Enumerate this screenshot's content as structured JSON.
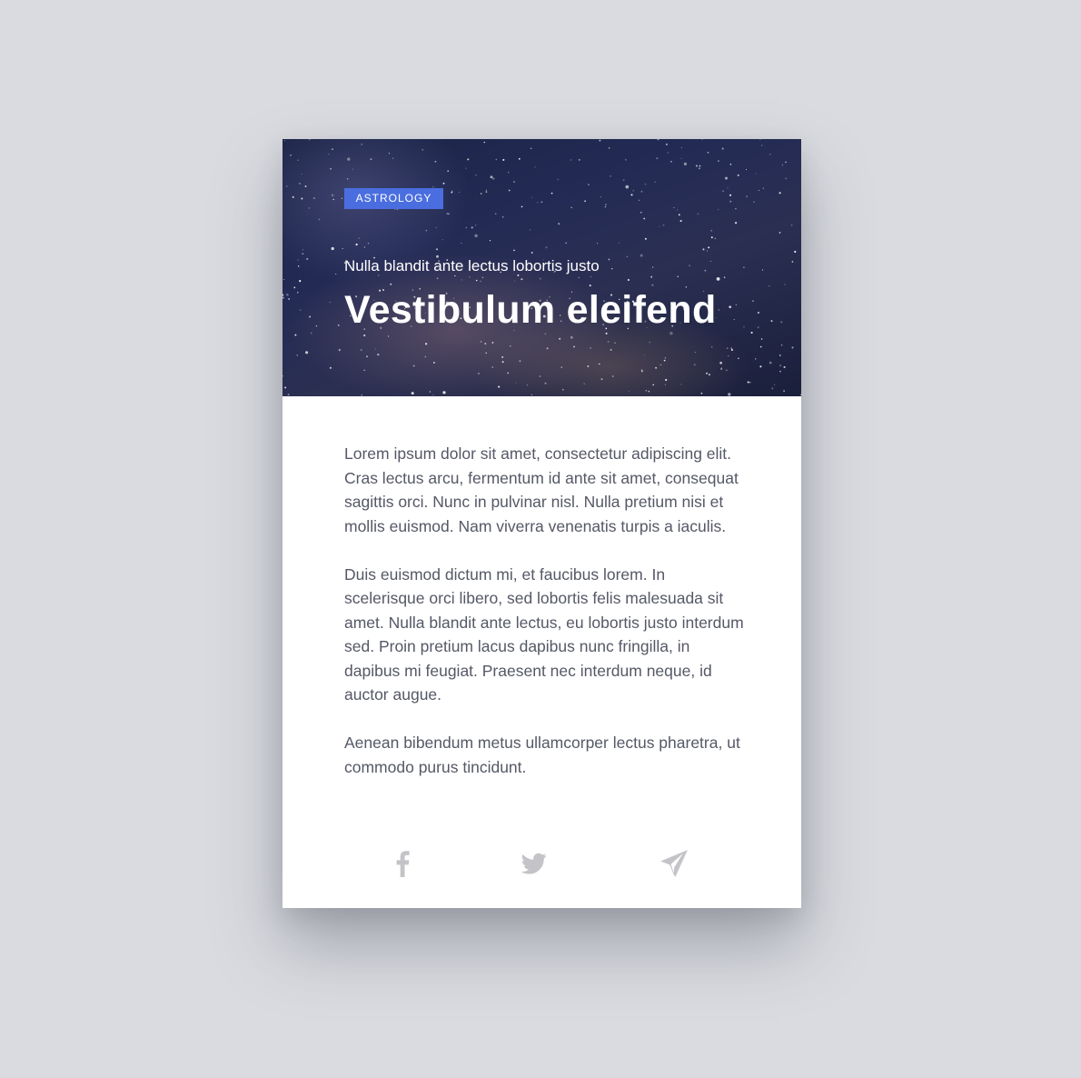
{
  "card": {
    "tag": "ASTROLOGY",
    "subtitle": "Nulla blandit ante lectus lobortis justo",
    "title": "Vestibulum eleifend",
    "paragraphs": [
      "Lorem ipsum dolor sit amet, consectetur adipiscing elit. Cras lectus arcu, fermentum id ante sit amet, consequat sagittis orci. Nunc in pulvinar nisl. Nulla pretium nisi et mollis euismod. Nam viverra venenatis turpis a iaculis.",
      "Duis euismod dictum mi, et faucibus lorem. In scelerisque orci libero, sed lobortis felis malesuada sit amet. Nulla blandit ante lectus, eu lobortis justo interdum sed. Proin pretium lacus dapibus nunc fringilla, in dapibus mi feugiat. Praesent nec interdum neque, id auctor augue.",
      "Aenean bibendum metus ullamcorper lectus pharetra, ut commodo purus tincidunt."
    ],
    "share": [
      {
        "icon": "facebook-icon"
      },
      {
        "icon": "twitter-icon"
      },
      {
        "icon": "send-icon"
      }
    ]
  },
  "colors": {
    "page_background": "#d9dbe0",
    "tag_background": "#4a6ee0",
    "body_text": "#555866",
    "icon": "#c4c4c8"
  }
}
